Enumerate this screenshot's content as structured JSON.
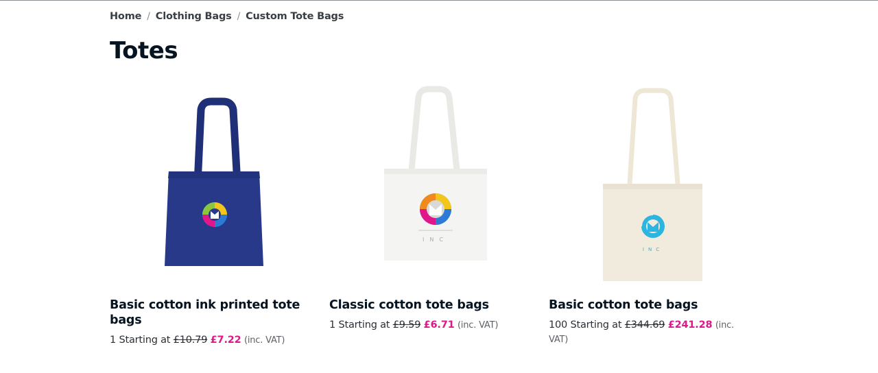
{
  "breadcrumb": {
    "items": [
      {
        "label": "Home"
      },
      {
        "label": "Clothing Bags"
      },
      {
        "label": "Custom Tote Bags"
      }
    ],
    "separator": "/"
  },
  "page": {
    "title": "Totes"
  },
  "colors": {
    "accent_price": "#e0168a",
    "heading": "#061421"
  },
  "products": [
    {
      "name": "Basic cotton ink printed tote bags",
      "qty": "1",
      "starting_label": "Starting at",
      "was_price": "£10.79",
      "price": "£7.22",
      "vat": "(inc. VAT)",
      "image": "navy-tote-bag-image"
    },
    {
      "name": "Classic cotton tote bags",
      "qty": "1",
      "starting_label": "Starting at",
      "was_price": "£9.59",
      "price": "£6.71",
      "vat": "(inc. VAT)",
      "image": "white-tote-bag-image"
    },
    {
      "name": "Basic cotton tote bags",
      "qty": "100",
      "starting_label": "Starting at",
      "was_price": "£344.69",
      "price": "£241.28",
      "vat": "(inc. VAT)",
      "image": "natural-tote-bag-image"
    }
  ],
  "logo_text": "INC"
}
